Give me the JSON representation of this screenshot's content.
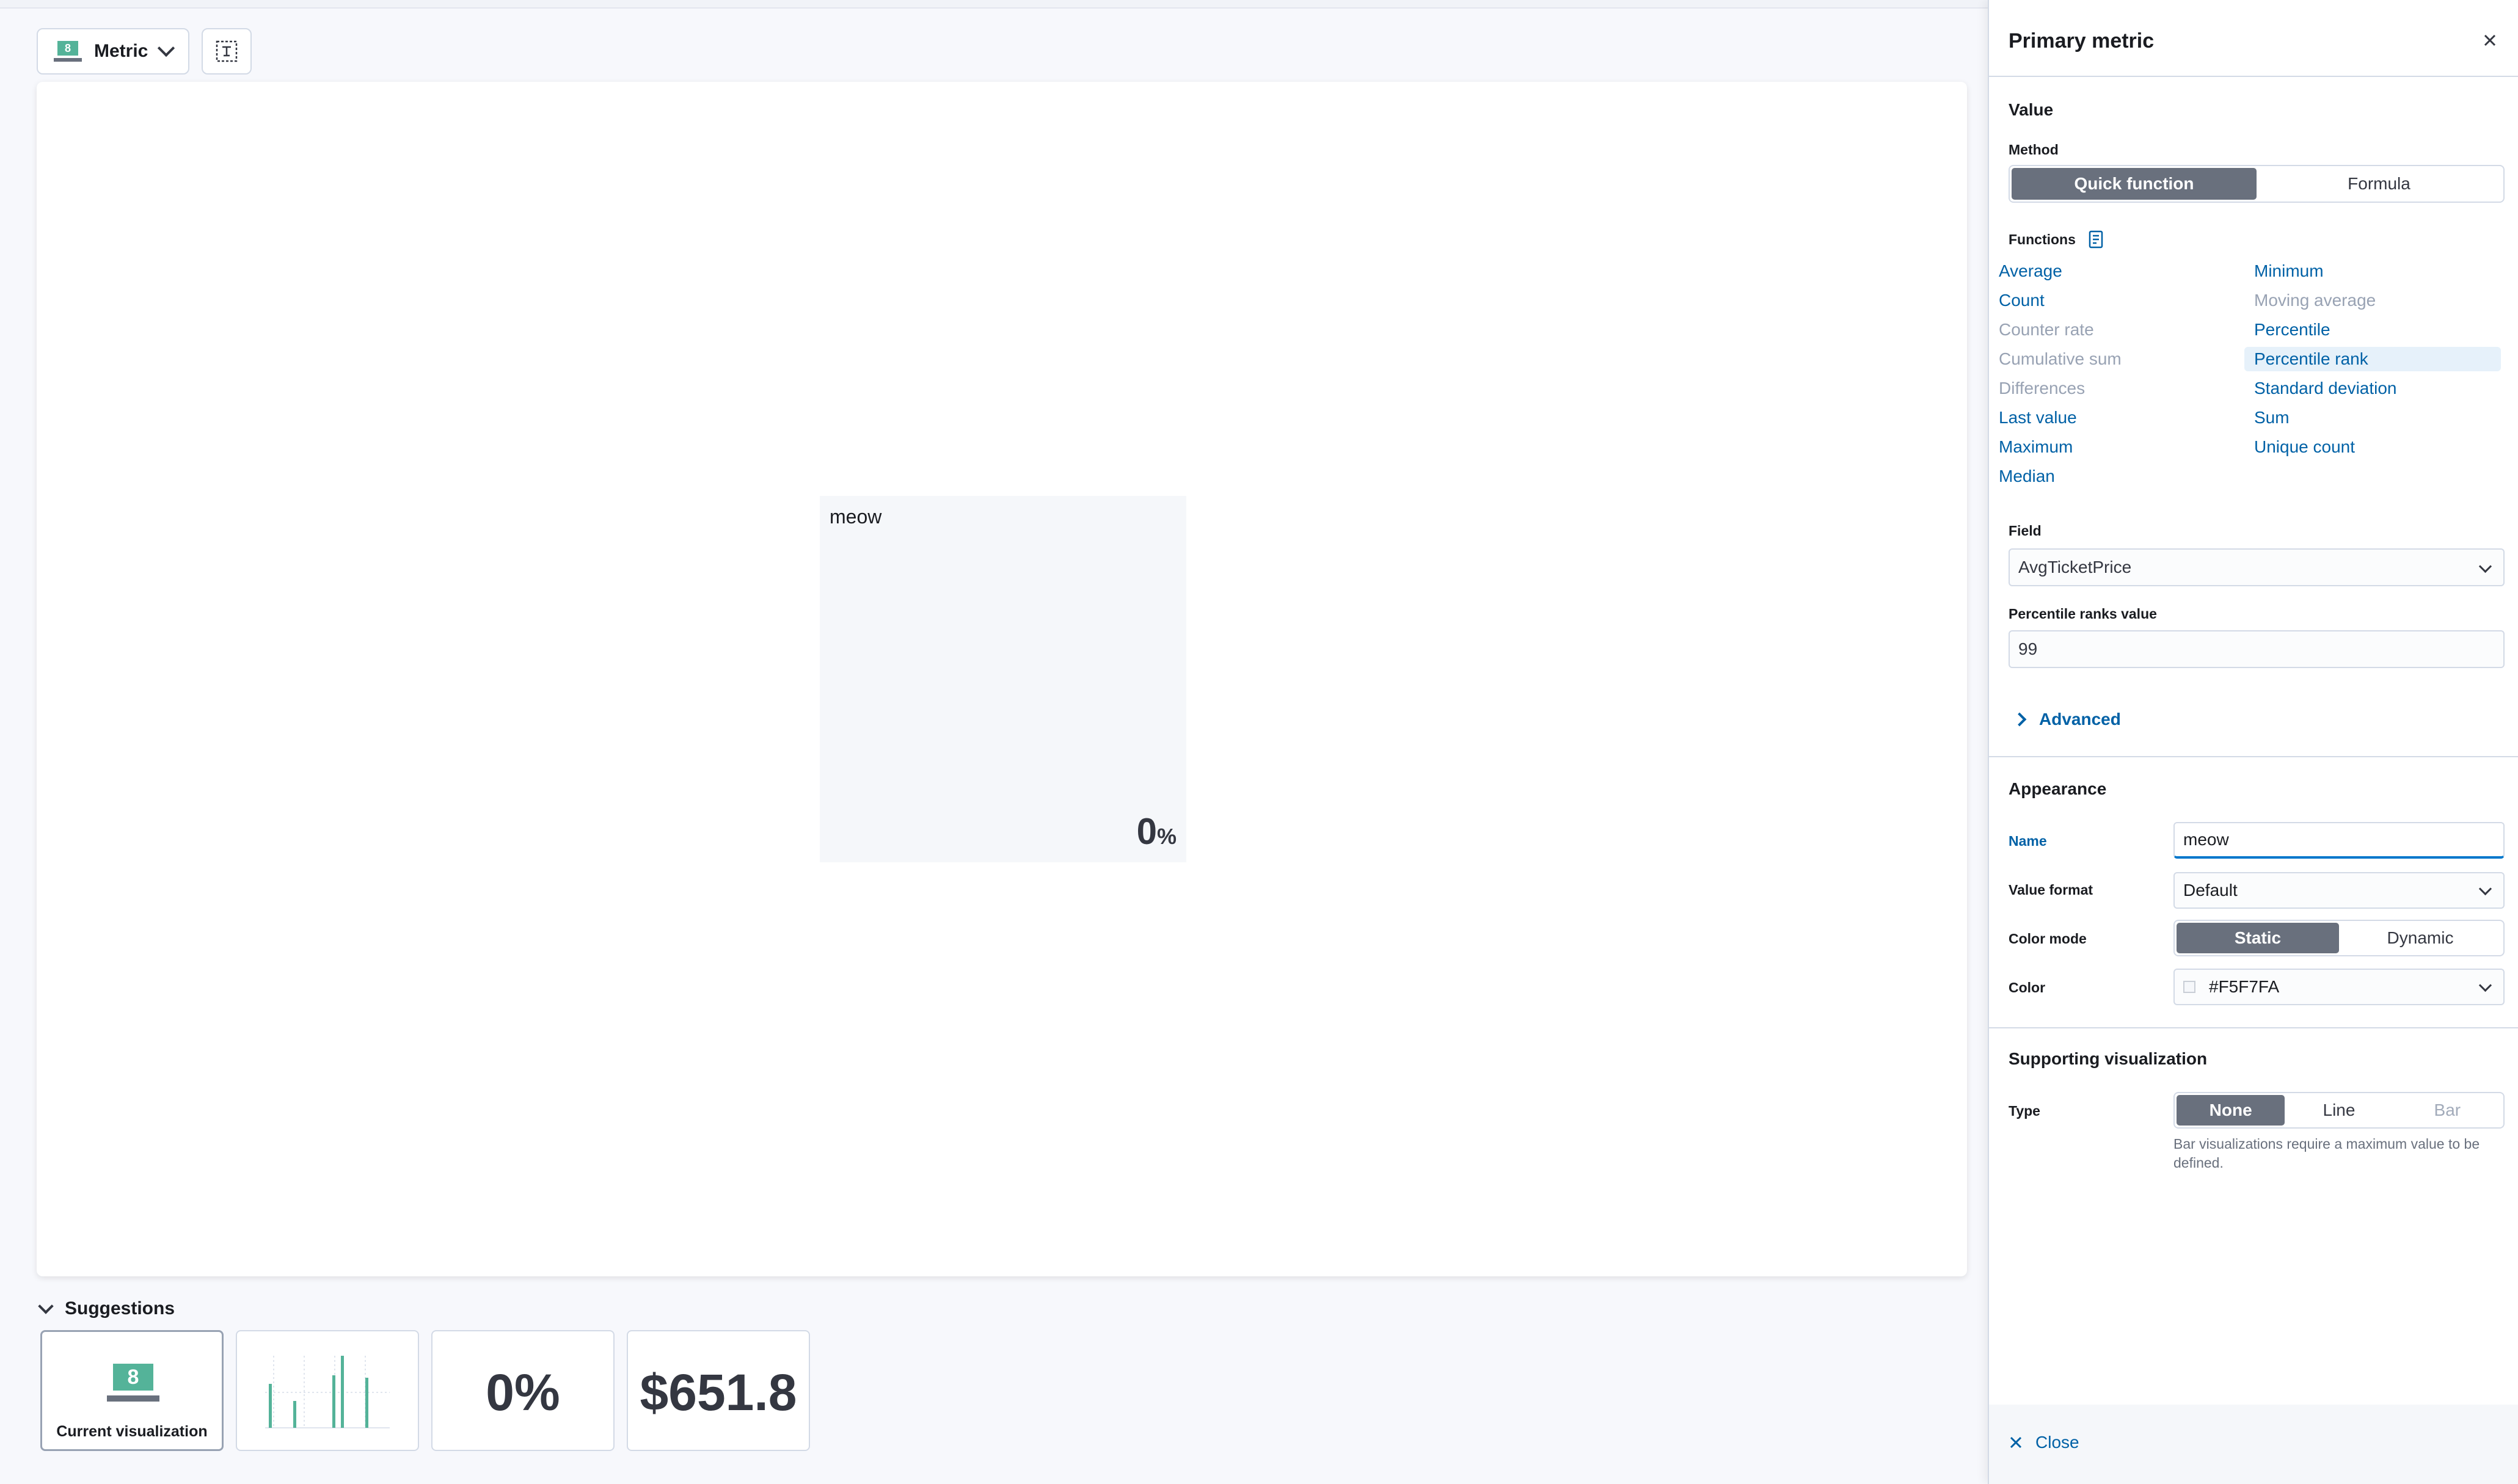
{
  "toolbar": {
    "vis_type_label": "Metric",
    "vis_icon_digit": "8"
  },
  "metric_tile": {
    "title": "meow",
    "value": "0",
    "unit": "%",
    "background": "#F5F7FA"
  },
  "suggestions": {
    "header": "Suggestions",
    "items": [
      {
        "type": "metric-icon",
        "icon_digit": "8",
        "caption": "Current visualization"
      },
      {
        "type": "bar-chart-icon"
      },
      {
        "type": "metric",
        "value": "0%"
      },
      {
        "type": "metric",
        "value": "$651.8"
      }
    ]
  },
  "flyout": {
    "title": "Primary metric",
    "value_section": "Value",
    "method_label": "Method",
    "method_options": [
      "Quick function",
      "Formula"
    ],
    "method_selected": "Quick function",
    "functions_label": "Functions",
    "functions_left": [
      {
        "label": "Average",
        "enabled": true
      },
      {
        "label": "Count",
        "enabled": true
      },
      {
        "label": "Counter rate",
        "enabled": false
      },
      {
        "label": "Cumulative sum",
        "enabled": false
      },
      {
        "label": "Differences",
        "enabled": false
      },
      {
        "label": "Last value",
        "enabled": true
      },
      {
        "label": "Maximum",
        "enabled": true
      },
      {
        "label": "Median",
        "enabled": true
      }
    ],
    "functions_right": [
      {
        "label": "Minimum",
        "enabled": true
      },
      {
        "label": "Moving average",
        "enabled": false
      },
      {
        "label": "Percentile",
        "enabled": true
      },
      {
        "label": "Percentile rank",
        "enabled": true,
        "selected": true
      },
      {
        "label": "Standard deviation",
        "enabled": true
      },
      {
        "label": "Sum",
        "enabled": true
      },
      {
        "label": "Unique count",
        "enabled": true
      }
    ],
    "field_label": "Field",
    "field_value": "AvgTicketPrice",
    "percentile_ranks_label": "Percentile ranks value",
    "percentile_ranks_value": "99",
    "advanced_label": "Advanced",
    "appearance_section": "Appearance",
    "name_label": "Name",
    "name_value": "meow",
    "value_format_label": "Value format",
    "value_format_value": "Default",
    "color_mode_label": "Color mode",
    "color_mode_options": [
      "Static",
      "Dynamic"
    ],
    "color_mode_selected": "Static",
    "color_label": "Color",
    "color_value": "#F5F7FA",
    "supporting_section": "Supporting visualization",
    "type_label": "Type",
    "type_options": [
      "None",
      "Line",
      "Bar"
    ],
    "type_selected": "None",
    "type_help": "Bar visualizations require a maximum value to be defined.",
    "close_label": "Close"
  },
  "colors": {
    "accent_link": "#0061A6",
    "selected_toggle": "#69707D",
    "metric_icon": "#54B399"
  }
}
